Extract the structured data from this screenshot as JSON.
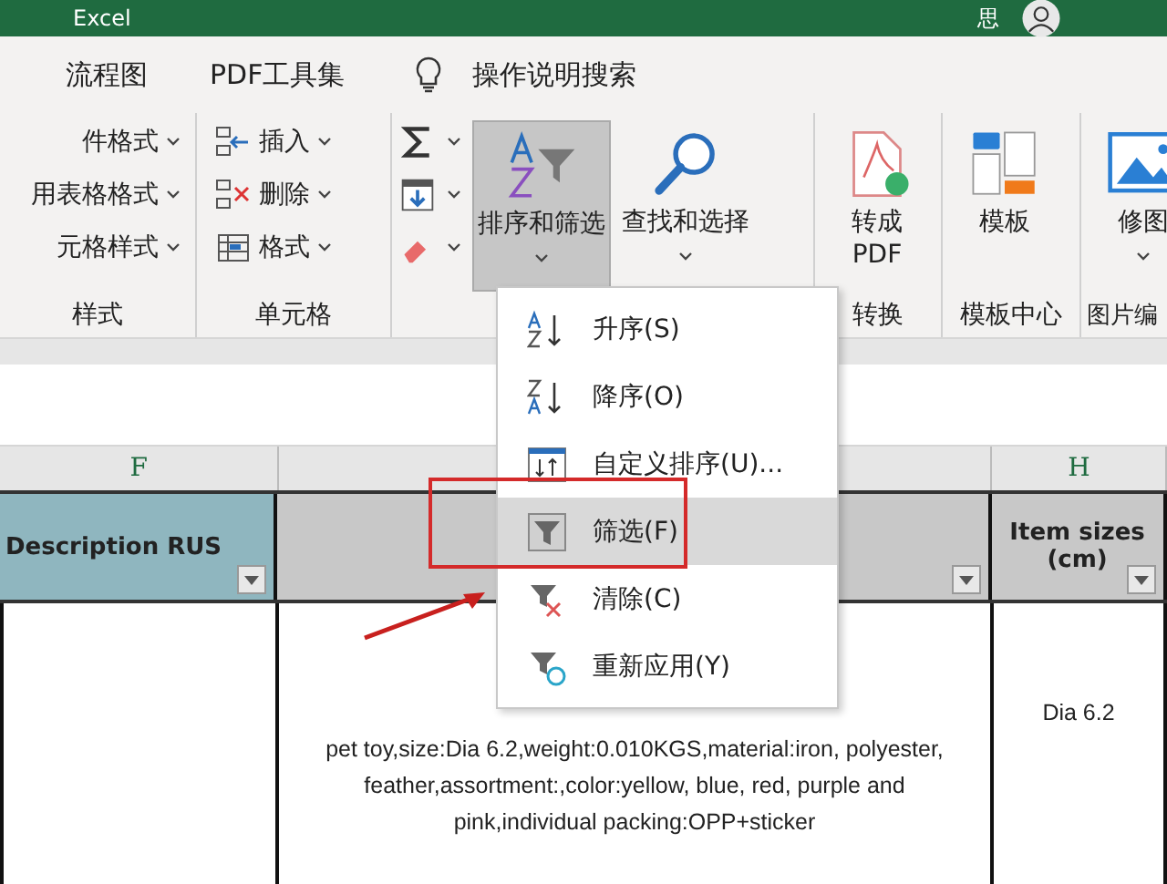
{
  "window": {
    "title": "Excel",
    "user": "思"
  },
  "menu_tabs": [
    {
      "label": "流程图"
    },
    {
      "label": "PDF工具集"
    }
  ],
  "tell_me": "操作说明搜索",
  "ribbon_groups": [
    {
      "label": "样式",
      "items": [
        {
          "kind": "small",
          "label": "件格式"
        },
        {
          "kind": "small",
          "label": "用表格格式"
        },
        {
          "kind": "small",
          "label": "元格样式"
        }
      ]
    },
    {
      "label": "单元格",
      "items": [
        {
          "kind": "small",
          "label": "插入"
        },
        {
          "kind": "small",
          "label": "删除"
        },
        {
          "kind": "small",
          "label": "格式"
        }
      ]
    },
    {
      "items": [
        {
          "kind": "icon"
        },
        {
          "kind": "icon"
        },
        {
          "kind": "icon"
        },
        {
          "kind": "large",
          "label": "排序和筛选",
          "pressed": true,
          "dropdown": true
        },
        {
          "kind": "large",
          "label": "查找和选择",
          "pressed": false,
          "dropdown": true
        }
      ]
    },
    {
      "label": "转换",
      "items": [
        {
          "kind": "large",
          "label": "转成\nPDF",
          "pressed": false,
          "dropdown": false
        }
      ]
    },
    {
      "label": "模板中心",
      "items": [
        {
          "kind": "large",
          "label": "模板",
          "pressed": false,
          "dropdown": false
        }
      ]
    },
    {
      "label": "图片编",
      "items": [
        {
          "kind": "large",
          "label": "修图",
          "pressed": false,
          "dropdown": true
        }
      ]
    }
  ],
  "sheet": {
    "columns": [
      {
        "letter": "F"
      },
      {},
      {
        "letter": "H"
      }
    ],
    "header_cells": [
      {
        "text": "Description RUS",
        "color": "#8fb6bf",
        "filter": true
      },
      {
        "color": "#c8c8c8",
        "filter": true
      },
      {
        "text": "Item sizes\n(cm)",
        "color": "#c8c8c8",
        "filter": true
      }
    ],
    "row": [
      {
        "text": "pet toy,size:Dia 6.2,weight:0.010KGS,material:iron, polyester, feather,assortment:,color:yellow, blue, red, purple and pink,individual packing:OPP+sticker"
      },
      {
        "text": "Dia 6.2"
      }
    ]
  },
  "sort_menu": [
    {
      "label": "升序(S)",
      "selected": false
    },
    {
      "label": "降序(O)",
      "selected": false
    },
    {
      "label": "自定义排序(U)...",
      "selected": false
    },
    {
      "label": "筛选(F)",
      "selected": true
    },
    {
      "label": "清除(C)",
      "selected": false
    },
    {
      "label": "重新应用(Y)",
      "selected": false
    }
  ]
}
